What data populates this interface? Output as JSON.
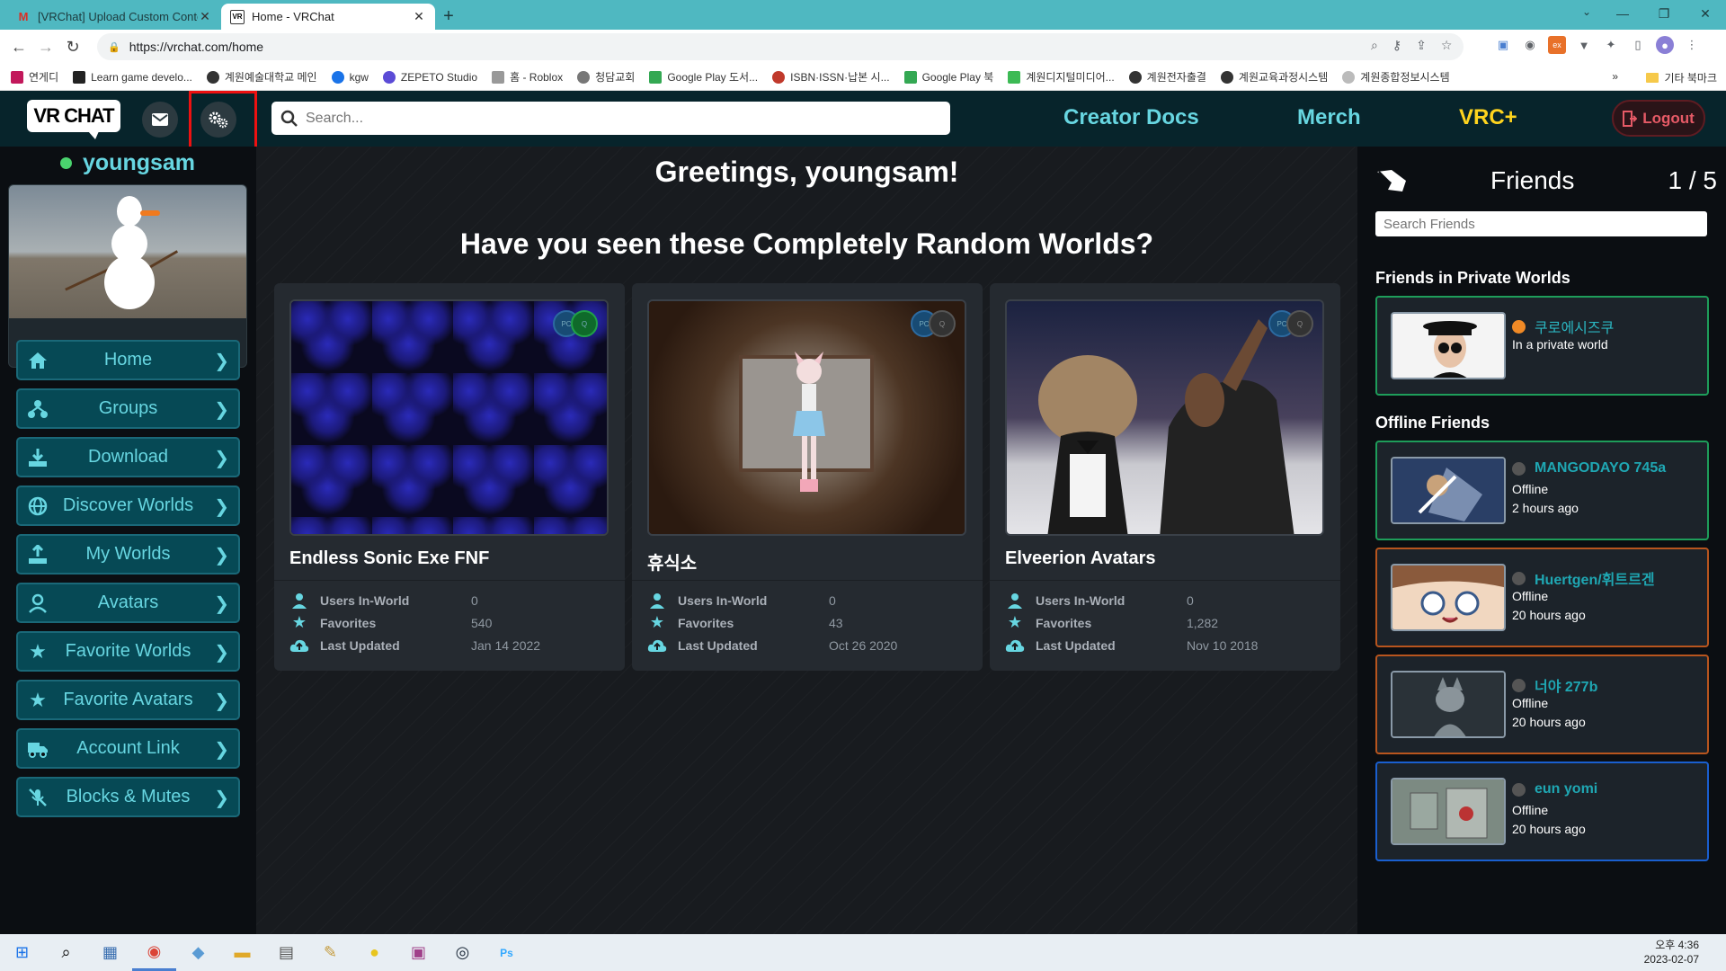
{
  "browser": {
    "tabs": [
      {
        "title": "[VRChat] Upload Custom Conte",
        "icon": "gmail-icon",
        "active": false
      },
      {
        "title": "Home - VRChat",
        "icon": "vrchat-icon",
        "active": true
      }
    ],
    "url": "https://vrchat.com/home",
    "bookmarks": [
      "연게디",
      "Learn game develo...",
      "계원예술대학교 메인",
      "kgw",
      "ZEPETO Studio",
      "홈 - Roblox",
      "청담교회",
      "Google Play 도서...",
      "ISBN·ISSN·납본 시...",
      "Google Play 북",
      "계원디지털미디어...",
      "계원전자출결",
      "계원교육과정시스템",
      "계원종합정보시스템"
    ],
    "bookmarks_more": "»",
    "other_bookmarks": "기타 북마크"
  },
  "header": {
    "logo": "VR CHAT",
    "search_placeholder": "Search...",
    "links": {
      "creator_docs": "Creator Docs",
      "merch": "Merch",
      "vrc_plus": "VRC+"
    },
    "logout": "Logout"
  },
  "user": {
    "name": "youngsam",
    "status_color": "#4ad36e"
  },
  "nav": [
    {
      "label": "Home",
      "icon": "home-icon"
    },
    {
      "label": "Groups",
      "icon": "groups-icon"
    },
    {
      "label": "Download",
      "icon": "download-icon"
    },
    {
      "label": "Discover Worlds",
      "icon": "globe-icon"
    },
    {
      "label": "My Worlds",
      "icon": "upload-icon"
    },
    {
      "label": "Avatars",
      "icon": "avatar-icon"
    },
    {
      "label": "Favorite Worlds",
      "icon": "star-icon"
    },
    {
      "label": "Favorite Avatars",
      "icon": "star-icon"
    },
    {
      "label": "Account Link",
      "icon": "truck-icon"
    },
    {
      "label": "Blocks & Mutes",
      "icon": "mute-icon"
    }
  ],
  "main": {
    "greeting": "Greetings, youngsam!",
    "subhead": "Have you seen these Completely Random Worlds?",
    "stat_labels": {
      "users": "Users In-World",
      "favorites": "Favorites",
      "updated": "Last Updated"
    },
    "worlds": [
      {
        "name": "Endless Sonic Exe FNF",
        "users": "0",
        "favorites": "540",
        "updated": "Jan 14 2022"
      },
      {
        "name": "휴식소",
        "users": "0",
        "favorites": "43",
        "updated": "Oct 26 2020"
      },
      {
        "name": "Elveerion Avatars",
        "users": "0",
        "favorites": "1,282",
        "updated": "Nov 10 2018"
      }
    ]
  },
  "friends": {
    "title": "Friends",
    "count": "1 / 5",
    "search_placeholder": "Search Friends",
    "private_heading": "Friends in Private Worlds",
    "offline_heading": "Offline Friends",
    "private": [
      {
        "name": "쿠로에시즈쿠",
        "status": "In a private world"
      }
    ],
    "offline": [
      {
        "name": "MANGODAYO 745a",
        "status": "Offline",
        "time": "2 hours ago"
      },
      {
        "name": "Huertgen/휘트르겐",
        "status": "Offline",
        "time": "20 hours ago"
      },
      {
        "name": "너야 277b",
        "status": "Offline",
        "time": "20 hours ago"
      },
      {
        "name": "eun yomi",
        "status": "Offline",
        "time": "20 hours ago"
      }
    ]
  },
  "taskbar": {
    "time": "오후 4:36",
    "date": "2023-02-07"
  }
}
